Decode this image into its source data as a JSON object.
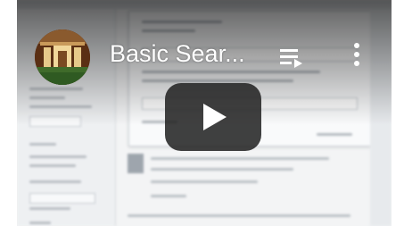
{
  "video": {
    "title": "Basic Sear...",
    "channel_avatar_icon": "channel-avatar-building-interior",
    "playlist_icon": "playlist-queue-icon",
    "more_icon": "more-vertical-icon",
    "play_icon": "play-icon"
  },
  "colors": {
    "play_button_bg": "#212121",
    "title_text": "#ffffff"
  }
}
